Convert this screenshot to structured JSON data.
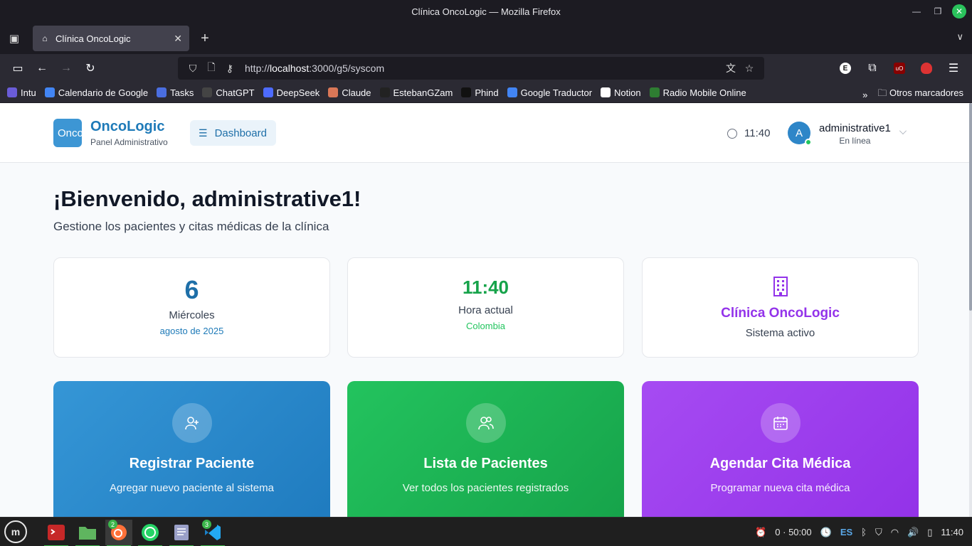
{
  "window": {
    "title": "Clínica OncoLogic — Mozilla Firefox"
  },
  "tabs": [
    {
      "label": "Clínica OncoLogic"
    }
  ],
  "urlbar": {
    "scheme": "http://",
    "host": "localhost",
    "path": ":3000/g5/syscom"
  },
  "bookmarks": [
    {
      "label": "Intu",
      "color": "#6a5cd8"
    },
    {
      "label": "Calendario de Google",
      "color": "#4285f4"
    },
    {
      "label": "Tasks",
      "color": "#4a6ee0"
    },
    {
      "label": "ChatGPT",
      "color": "#444444"
    },
    {
      "label": "DeepSeek",
      "color": "#4d6bfe"
    },
    {
      "label": "Claude",
      "color": "#d97757"
    },
    {
      "label": "EstebanGZam",
      "color": "#222222"
    },
    {
      "label": "Phind",
      "color": "#111111"
    },
    {
      "label": "Google Traductor",
      "color": "#4285f4"
    },
    {
      "label": "Notion",
      "color": "#ffffff"
    },
    {
      "label": "Radio Mobile Online",
      "color": "#2e7d32"
    }
  ],
  "bookmarks_other": "Otros marcadores",
  "app": {
    "logo_text": "Onco",
    "brand_name": "OncoLogic",
    "brand_sub": "Panel Administrativo",
    "nav_button": "Dashboard",
    "time": "11:40",
    "avatar_initial": "A",
    "username": "administrative1",
    "user_status": "En línea"
  },
  "welcome": {
    "title": "¡Bienvenido, administrative1!",
    "subtitle": "Gestione los pacientes y citas médicas de la clínica"
  },
  "cards": {
    "date": {
      "day": "6",
      "weekday": "Miércoles",
      "month": "agosto de 2025"
    },
    "clock": {
      "time": "11:40",
      "label": "Hora actual",
      "region": "Colombia"
    },
    "clinic": {
      "name": "Clínica OncoLogic",
      "status": "Sistema activo"
    }
  },
  "actions": [
    {
      "title": "Registrar Paciente",
      "desc": "Agregar nuevo paciente al sistema"
    },
    {
      "title": "Lista de Pacientes",
      "desc": "Ver todos los pacientes registrados"
    },
    {
      "title": "Agendar Cita Médica",
      "desc": "Programar nueva cita médica"
    }
  ],
  "taskbar": {
    "badges": {
      "firefox": "2",
      "vscode": "3"
    },
    "timer": "0 · 50:00",
    "lang": "ES",
    "clock": "11:40"
  }
}
